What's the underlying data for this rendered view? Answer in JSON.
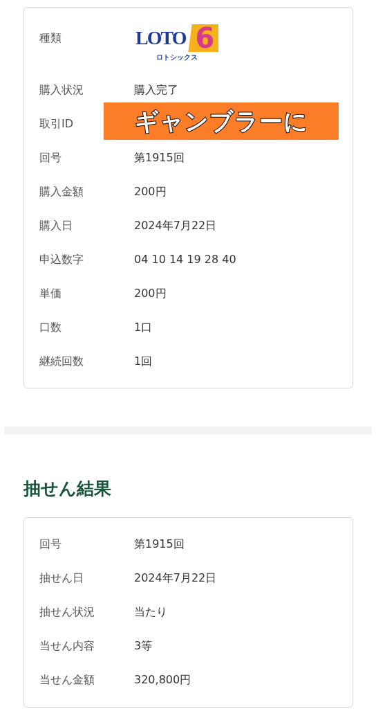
{
  "purchase": {
    "rows": [
      {
        "kind": "logo",
        "label": "種類",
        "logo": {
          "word": "LOTO",
          "digit": "6",
          "reading": "ロトシックス"
        }
      },
      {
        "kind": "text",
        "label": "購入状況",
        "value": "購入完了"
      },
      {
        "kind": "redacted",
        "label": "取引ID",
        "banner": "ギャンブラーに"
      },
      {
        "kind": "text",
        "label": "回号",
        "value": "第1915回"
      },
      {
        "kind": "text",
        "label": "購入金額",
        "value": "200円"
      },
      {
        "kind": "text",
        "label": "購入日",
        "value": "2024年7月22日"
      },
      {
        "kind": "text",
        "label": "申込数字",
        "value": "04 10 14 19 28 40"
      },
      {
        "kind": "text",
        "label": "単価",
        "value": "200円"
      },
      {
        "kind": "text",
        "label": "口数",
        "value": "1口"
      },
      {
        "kind": "text",
        "label": "継続回数",
        "value": "1回"
      }
    ]
  },
  "result": {
    "title": "抽せん結果",
    "rows": [
      {
        "kind": "text",
        "label": "回号",
        "value": "第1915回"
      },
      {
        "kind": "text",
        "label": "抽せん日",
        "value": "2024年7月22日"
      },
      {
        "kind": "text",
        "label": "抽せん状況",
        "value": "当たり"
      },
      {
        "kind": "text",
        "label": "当せん内容",
        "value": "3等"
      },
      {
        "kind": "text",
        "label": "当せん金額",
        "value": "320,800円"
      }
    ]
  }
}
